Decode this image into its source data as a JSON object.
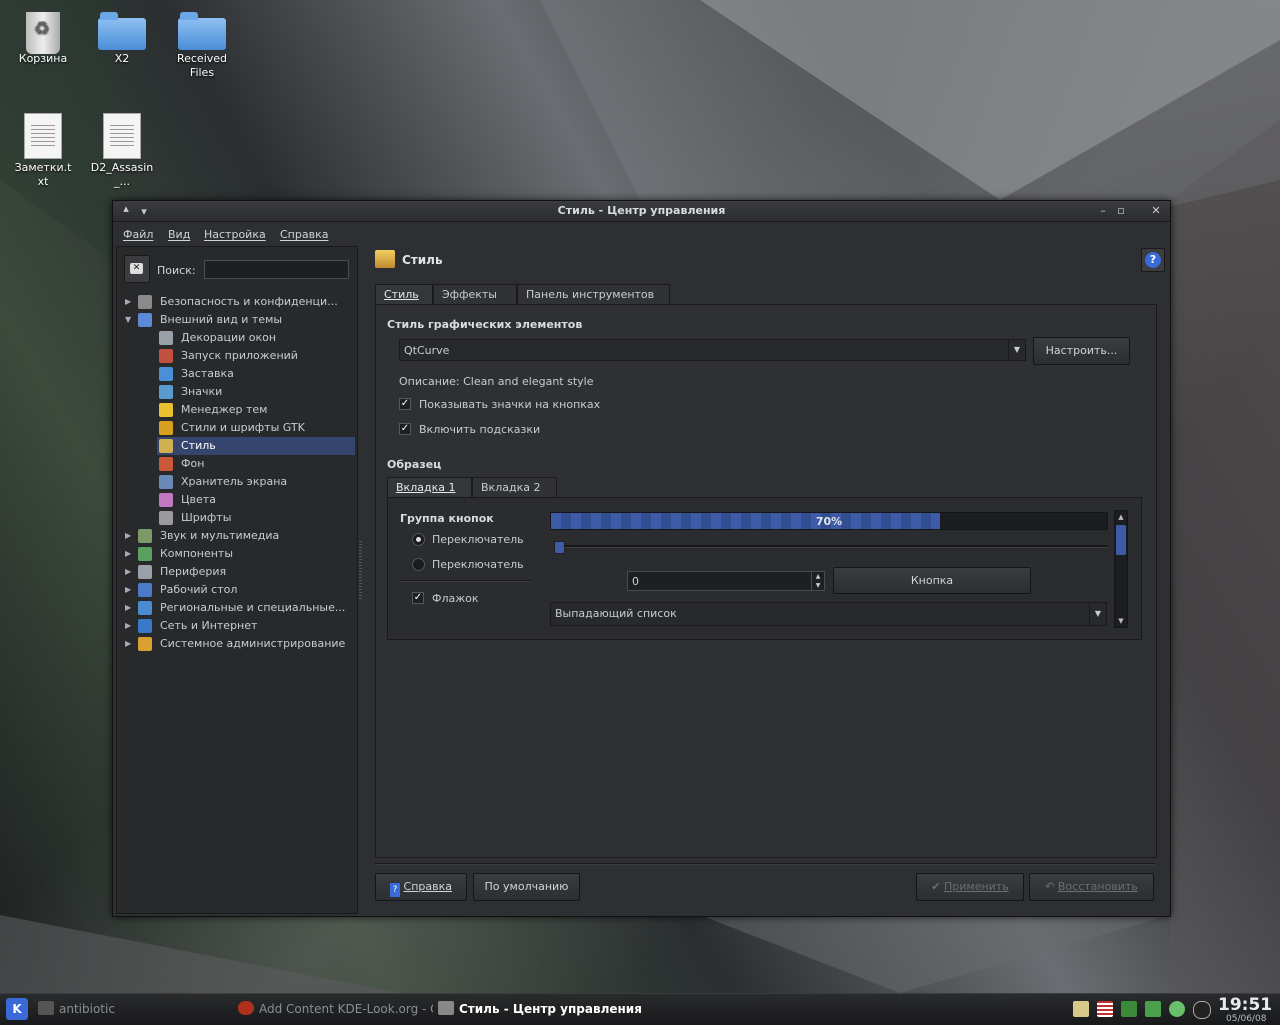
{
  "desktop": {
    "icons": [
      {
        "label": "Корзина"
      },
      {
        "label": "X2"
      },
      {
        "label": "Received Files"
      },
      {
        "label": "Заметки.txt"
      },
      {
        "label": "D2_Assasin_..."
      }
    ]
  },
  "window": {
    "title": "Стиль - Центр управления",
    "menu": [
      "Файл",
      "Вид",
      "Настройка",
      "Справка"
    ]
  },
  "left": {
    "search_label": "Поиск:",
    "search_value": "",
    "tree": [
      {
        "label": "Безопасность и конфиденци...",
        "expander": "▶",
        "color": "#8a8a8a"
      },
      {
        "label": "Внешний вид и темы",
        "expander": "▼",
        "color": "#5a8ad8"
      },
      {
        "label": "Декорации окон",
        "expander": "",
        "color": "#9aa0a8"
      },
      {
        "label": "Запуск приложений",
        "expander": "",
        "color": "#c05040"
      },
      {
        "label": "Заставка",
        "expander": "",
        "color": "#4a90d8"
      },
      {
        "label": "Значки",
        "expander": "",
        "color": "#5a9ad0"
      },
      {
        "label": "Менеджер тем",
        "expander": "",
        "color": "#e8c030"
      },
      {
        "label": "Стили и шрифты GTK",
        "expander": "",
        "color": "#d8a020"
      },
      {
        "label": "Стиль",
        "expander": "",
        "color": "#d0b050",
        "selected": true
      },
      {
        "label": "Фон",
        "expander": "",
        "color": "#c85838"
      },
      {
        "label": "Хранитель экрана",
        "expander": "",
        "color": "#6a8ab8"
      },
      {
        "label": "Цвета",
        "expander": "",
        "color": "#c078c0"
      },
      {
        "label": "Шрифты",
        "expander": "",
        "color": "#9a9aa0"
      },
      {
        "label": "Звук и мультимедиа",
        "expander": "▶",
        "color": "#7a9a6a"
      },
      {
        "label": "Компоненты",
        "expander": "▶",
        "color": "#5aa060"
      },
      {
        "label": "Периферия",
        "expander": "▶",
        "color": "#9aa0a8"
      },
      {
        "label": "Рабочий стол",
        "expander": "▶",
        "color": "#4a7ac8"
      },
      {
        "label": "Региональные и специальные...",
        "expander": "▶",
        "color": "#4a8ad0"
      },
      {
        "label": "Сеть и Интернет",
        "expander": "▶",
        "color": "#3a78c8"
      },
      {
        "label": "Системное администрирование",
        "expander": "▶",
        "color": "#d8a030"
      }
    ]
  },
  "page": {
    "title": "Стиль",
    "tabs": [
      "Стиль",
      "Эффекты",
      "Панель инструментов"
    ],
    "widget_style_title": "Стиль графических элементов",
    "style_combo_value": "QtCurve",
    "configure_button": "Настроить...",
    "description": "Описание: Clean and elegant style",
    "check_icons": "Показывать значки на кнопках",
    "check_tooltips": "Включить подсказки",
    "preview_title": "Образец",
    "preview_tabs": [
      "Вкладка 1",
      "Вкладка 2"
    ],
    "button_group_title": "Группа кнопок",
    "radio1": "Переключатель",
    "radio2": "Переключатель",
    "checkbox_label": "Флажок",
    "progress_value": 0.7,
    "progress_text": "70%",
    "slider_value": 0,
    "spin_value": "0",
    "preview_button": "Кнопка",
    "preview_combo": "Выпадающий список",
    "bottom_help": "Справка",
    "bottom_defaults": "По умолчанию",
    "bottom_apply": "Применить",
    "bottom_reset": "Восстановить"
  },
  "taskbar": {
    "tasks": [
      {
        "label": "antibiotic",
        "active": false
      },
      {
        "label": "Add Content KDE-Look.org - O...",
        "active": false
      },
      {
        "label": "Стиль - Центр управления",
        "active": true
      }
    ],
    "time": "19:51",
    "date": "05/06/08"
  },
  "colors": {
    "accent": "#3e5ba8",
    "selection": "#36456e"
  }
}
